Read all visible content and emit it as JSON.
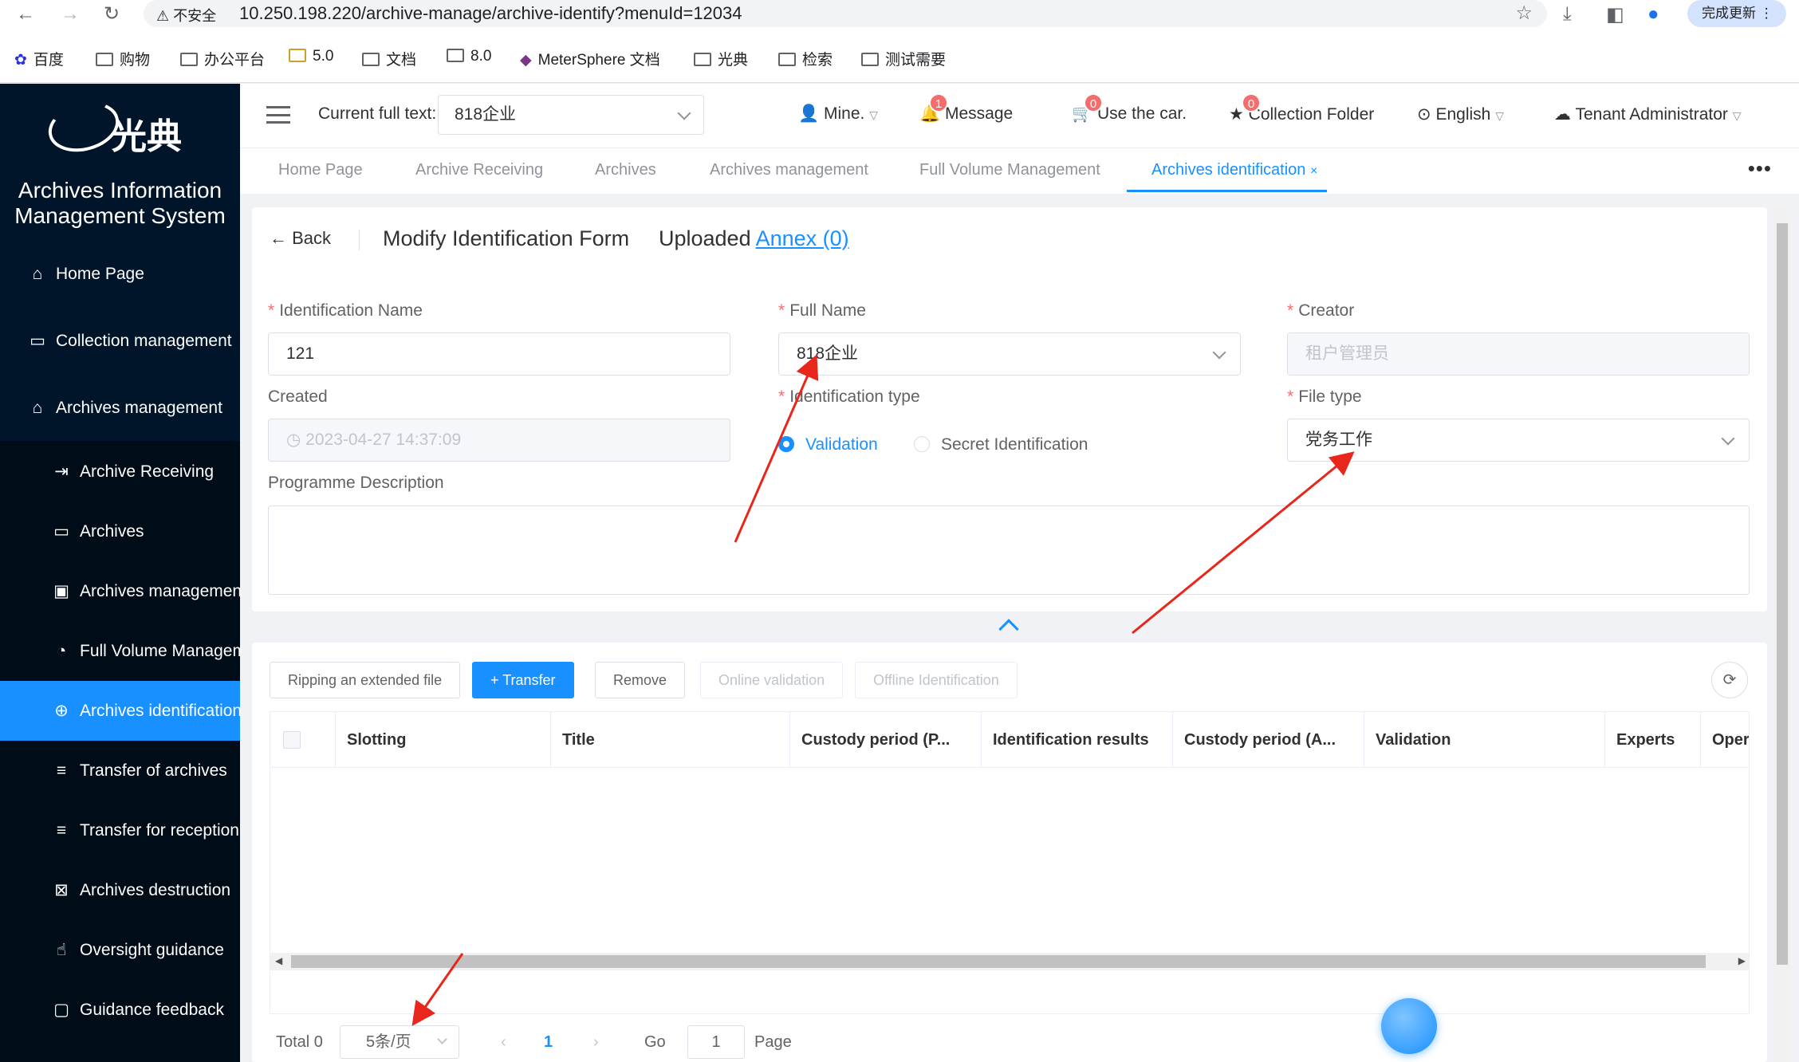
{
  "browser": {
    "security_label": "不安全",
    "url": "10.250.198.220/archive-manage/archive-identify?menuId=12034",
    "update_button": "完成更新",
    "bookmarks": [
      "百度",
      "购物",
      "办公平台",
      "5.0",
      "文档",
      "8.0",
      "MeterSphere 文档",
      "光典",
      "检索",
      "测试需要"
    ]
  },
  "sidebar": {
    "logo_text": "光典",
    "system_title_line1": "Archives Information",
    "system_title_line2": "Management System",
    "top_items": [
      {
        "label": "Home Page",
        "icon": "home-icon"
      },
      {
        "label": "Collection management",
        "icon": "collection-icon"
      },
      {
        "label": "Archives management",
        "icon": "bank-icon"
      }
    ],
    "sub_items": [
      {
        "label": "Archive Receiving",
        "icon": "receive-icon"
      },
      {
        "label": "Archives",
        "icon": "folder-icon"
      },
      {
        "label": "Archives management",
        "icon": "briefcase-icon"
      },
      {
        "label": "Full Volume Management",
        "icon": "dashboard-icon"
      },
      {
        "label": "Archives identification",
        "icon": "compass-icon",
        "active": true
      },
      {
        "label": "Transfer of archives",
        "icon": "list-icon"
      },
      {
        "label": "Transfer for reception",
        "icon": "list-icon"
      },
      {
        "label": "Archives destruction",
        "icon": "destroy-icon"
      },
      {
        "label": "Oversight guidance",
        "icon": "hand-icon"
      },
      {
        "label": "Guidance feedback",
        "icon": "chat-icon"
      }
    ]
  },
  "header": {
    "current_label": "Current full text:",
    "current_value": "818企业",
    "user": "Mine.",
    "message": "Message",
    "message_count": "1",
    "car": "Use the car.",
    "car_count": "0",
    "collection": "Collection Folder",
    "collection_count": "0",
    "language": "English",
    "role": "Tenant Administrator"
  },
  "tabs": [
    "Home Page",
    "Archive Receiving",
    "Archives",
    "Archives management",
    "Full Volume Management",
    "Archives identification"
  ],
  "form": {
    "back": "Back",
    "title": "Modify Identification Form",
    "uploaded_prefix": "Uploaded",
    "annex": "Annex (0)",
    "labels": {
      "identification_name": "Identification Name",
      "full_name": "Full Name",
      "creator": "Creator",
      "created": "Created",
      "identification_type": "Identification type",
      "file_type": "File type",
      "programme_description": "Programme Description"
    },
    "values": {
      "identification_name": "121",
      "full_name": "818企业",
      "creator": "租户管理员",
      "created": "2023-04-27 14:37:09",
      "file_type": "党务工作"
    },
    "radio_options": [
      "Validation",
      "Secret Identification"
    ],
    "radio_selected": "Validation"
  },
  "toolbar": {
    "buttons": [
      "Ripping an extended file",
      "Transfer",
      "Remove",
      "Online validation",
      "Offline Identification"
    ]
  },
  "table": {
    "columns": [
      "Slotting",
      "Title",
      "Custody period (P...",
      "Identification results",
      "Custody period (A...",
      "Validation",
      "Experts",
      "Oper"
    ],
    "rows": []
  },
  "pagination": {
    "total": "Total 0",
    "page_size": "5条/页",
    "current_page": "1",
    "go_label": "Go",
    "go_value": "1",
    "page_label": "Page"
  },
  "colors": {
    "primary": "#1890ff",
    "sidebar_bg": "#001529",
    "required": "#f56c6c",
    "annotation": "#e8261c"
  }
}
